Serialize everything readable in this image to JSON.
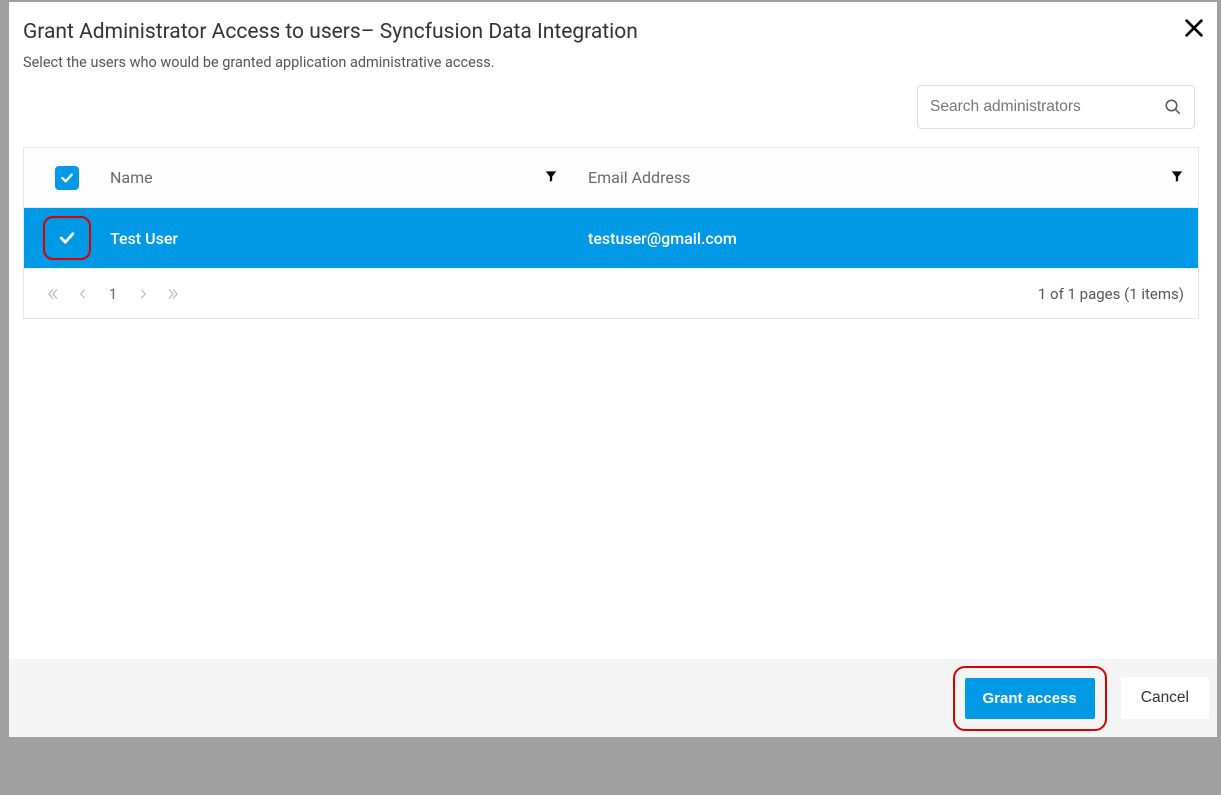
{
  "modal": {
    "title": "Grant Administrator Access to users– Syncfusion Data Integration",
    "subtitle": "Select the users who would be granted application administrative access.",
    "search_placeholder": "Search administrators"
  },
  "table": {
    "columns": {
      "name": "Name",
      "email": "Email Address"
    },
    "rows": [
      {
        "name": "Test User",
        "email": "testuser@gmail.com",
        "checked": true
      }
    ]
  },
  "pagination": {
    "current_page": "1",
    "info": "1 of 1 pages (1 items)"
  },
  "footer": {
    "grant_label": "Grant access",
    "cancel_label": "Cancel"
  }
}
